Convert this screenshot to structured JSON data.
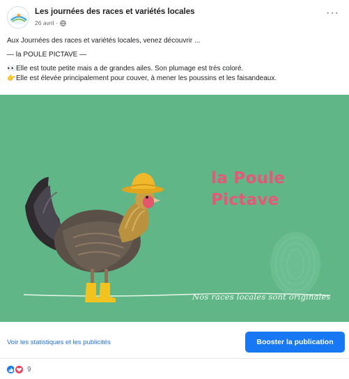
{
  "post": {
    "page_name": "Les journées des races et variétés locales",
    "date": "26 avril",
    "separator": "·",
    "more_label": "···",
    "text": {
      "line1": "Aux Journées des races et variétés locales, venez découvrir ...",
      "line2": "— la POULE PICTAVE —",
      "line3_emoji": "👀",
      "line3": "Elle est toute petite mais a de grandes ailes. Son plumage est très coloré.",
      "line4_emoji": "👉",
      "line4": "Elle est élevée principalement pour couver, à mener les poussins et les faisandeaux."
    }
  },
  "image": {
    "title_line1": "la Poule",
    "title_line2": "Pictave",
    "tagline": "Nos races locales sont originales",
    "background_color": "#61b687",
    "title_color": "#e4587a"
  },
  "footer": {
    "stats_link": "Voir les statistiques et les publicités",
    "boost_button": "Booster la publication",
    "reaction_count": "9"
  },
  "icons": [
    "globe-icon",
    "more-options-icon",
    "like-reaction-icon",
    "love-reaction-icon",
    "eyes-emoji-icon",
    "pointing-hand-emoji-icon"
  ],
  "colors": {
    "accent": "#1877f2",
    "link": "#216fdb",
    "love": "#f33e58"
  }
}
